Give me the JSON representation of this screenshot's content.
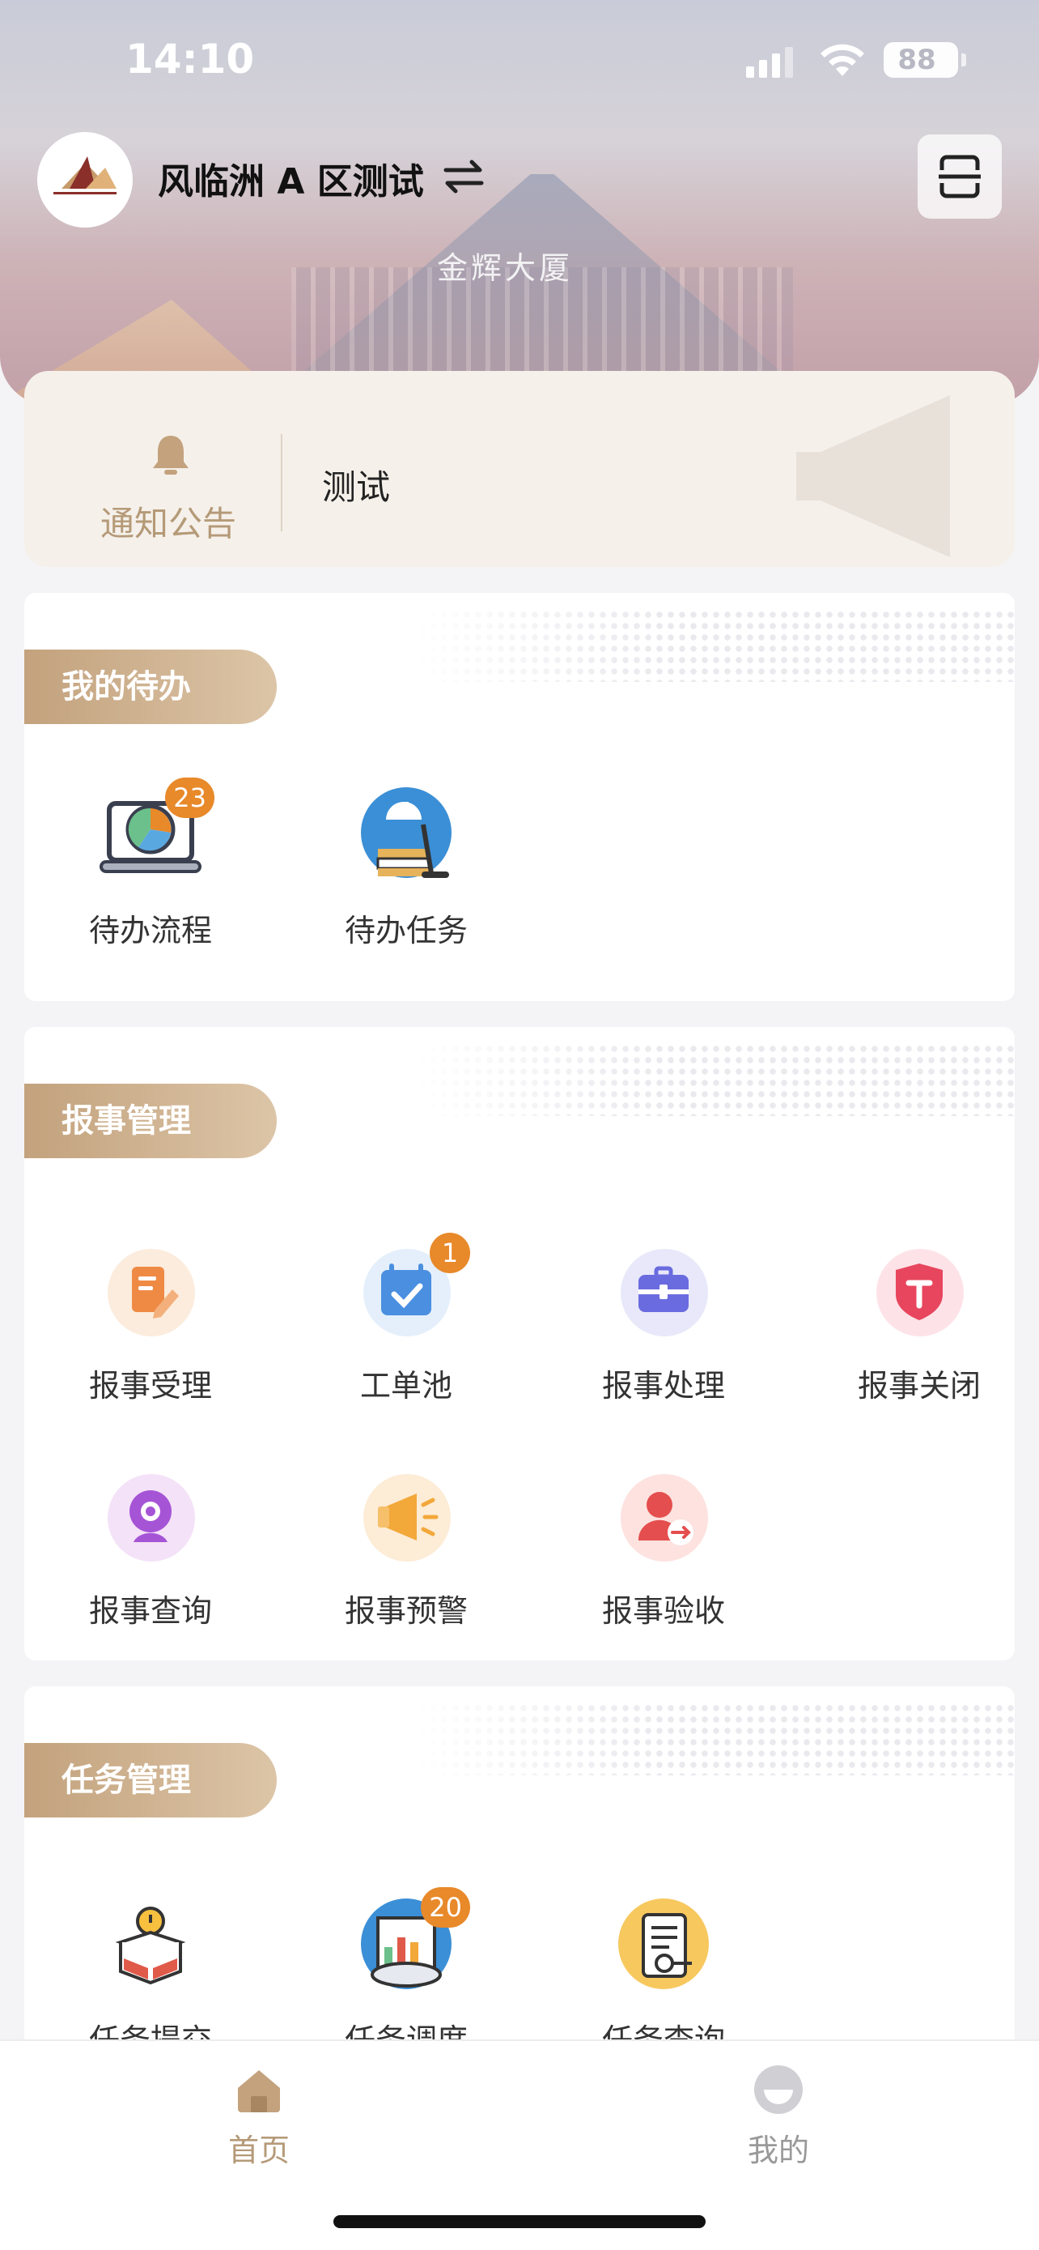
{
  "status": {
    "time": "14:10",
    "battery": "88"
  },
  "header": {
    "project": "风临洲 A 区测试",
    "sign_text": "金辉大厦"
  },
  "notice": {
    "label": "通知公告",
    "text": "测试"
  },
  "sections": {
    "todo": {
      "title": "我的待办",
      "items": [
        {
          "label": "待办流程",
          "badge": "23"
        },
        {
          "label": "待办任务"
        }
      ]
    },
    "report": {
      "title": "报事管理",
      "items": [
        {
          "label": "报事受理"
        },
        {
          "label": "工单池",
          "badge": "1"
        },
        {
          "label": "报事处理"
        },
        {
          "label": "报事关闭"
        },
        {
          "label": "报事查询"
        },
        {
          "label": "报事预警"
        },
        {
          "label": "报事验收"
        }
      ]
    },
    "task": {
      "title": "任务管理",
      "items": [
        {
          "label": "任务提交"
        },
        {
          "label": "任务调度",
          "badge": "20"
        },
        {
          "label": "任务查询"
        }
      ]
    }
  },
  "tabs": [
    {
      "label": "首页",
      "active": true
    },
    {
      "label": "我的",
      "active": false
    }
  ],
  "colors": {
    "accent": "#b59a78",
    "badge": "#e8892a"
  }
}
